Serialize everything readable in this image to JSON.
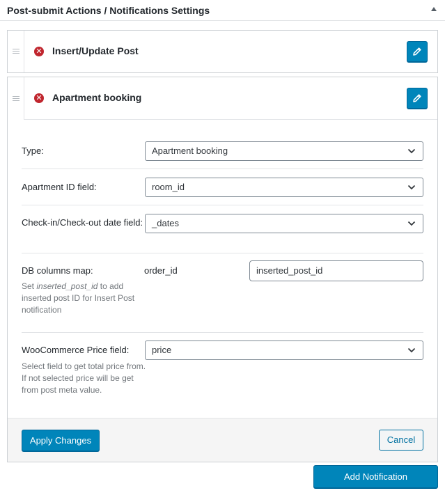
{
  "panel": {
    "title": "Post-submit Actions / Notifications Settings"
  },
  "notifications": [
    {
      "title": "Insert/Update Post",
      "status": "error"
    },
    {
      "title": "Apartment booking",
      "status": "error"
    }
  ],
  "editor": {
    "type": {
      "label": "Type:",
      "value": "Apartment booking"
    },
    "apartment_id": {
      "label": "Apartment ID field:",
      "value": "room_id"
    },
    "dates": {
      "label": "Check-in/Check-out date field:",
      "value": "_dates"
    },
    "db_map": {
      "label": "DB columns map:",
      "desc_prefix": "Set ",
      "desc_em": "inserted_post_id",
      "desc_suffix": " to add inserted post ID for Insert Post notification",
      "key": "order_id",
      "value": "inserted_post_id"
    },
    "price": {
      "label": "WooCommerce Price field:",
      "desc": "Select field to get total price from. If not selected price will be get from post meta value.",
      "value": "price"
    }
  },
  "buttons": {
    "apply": "Apply Changes",
    "cancel": "Cancel",
    "add": "Add Notification"
  },
  "colors": {
    "primary": "#0085ba",
    "error": "#c0262e",
    "border": "#ccd0d4"
  },
  "icons": {
    "error": "error-x-icon",
    "edit": "pencil-icon",
    "drag": "drag-handle-icon",
    "select": "chevron-down-icon"
  }
}
